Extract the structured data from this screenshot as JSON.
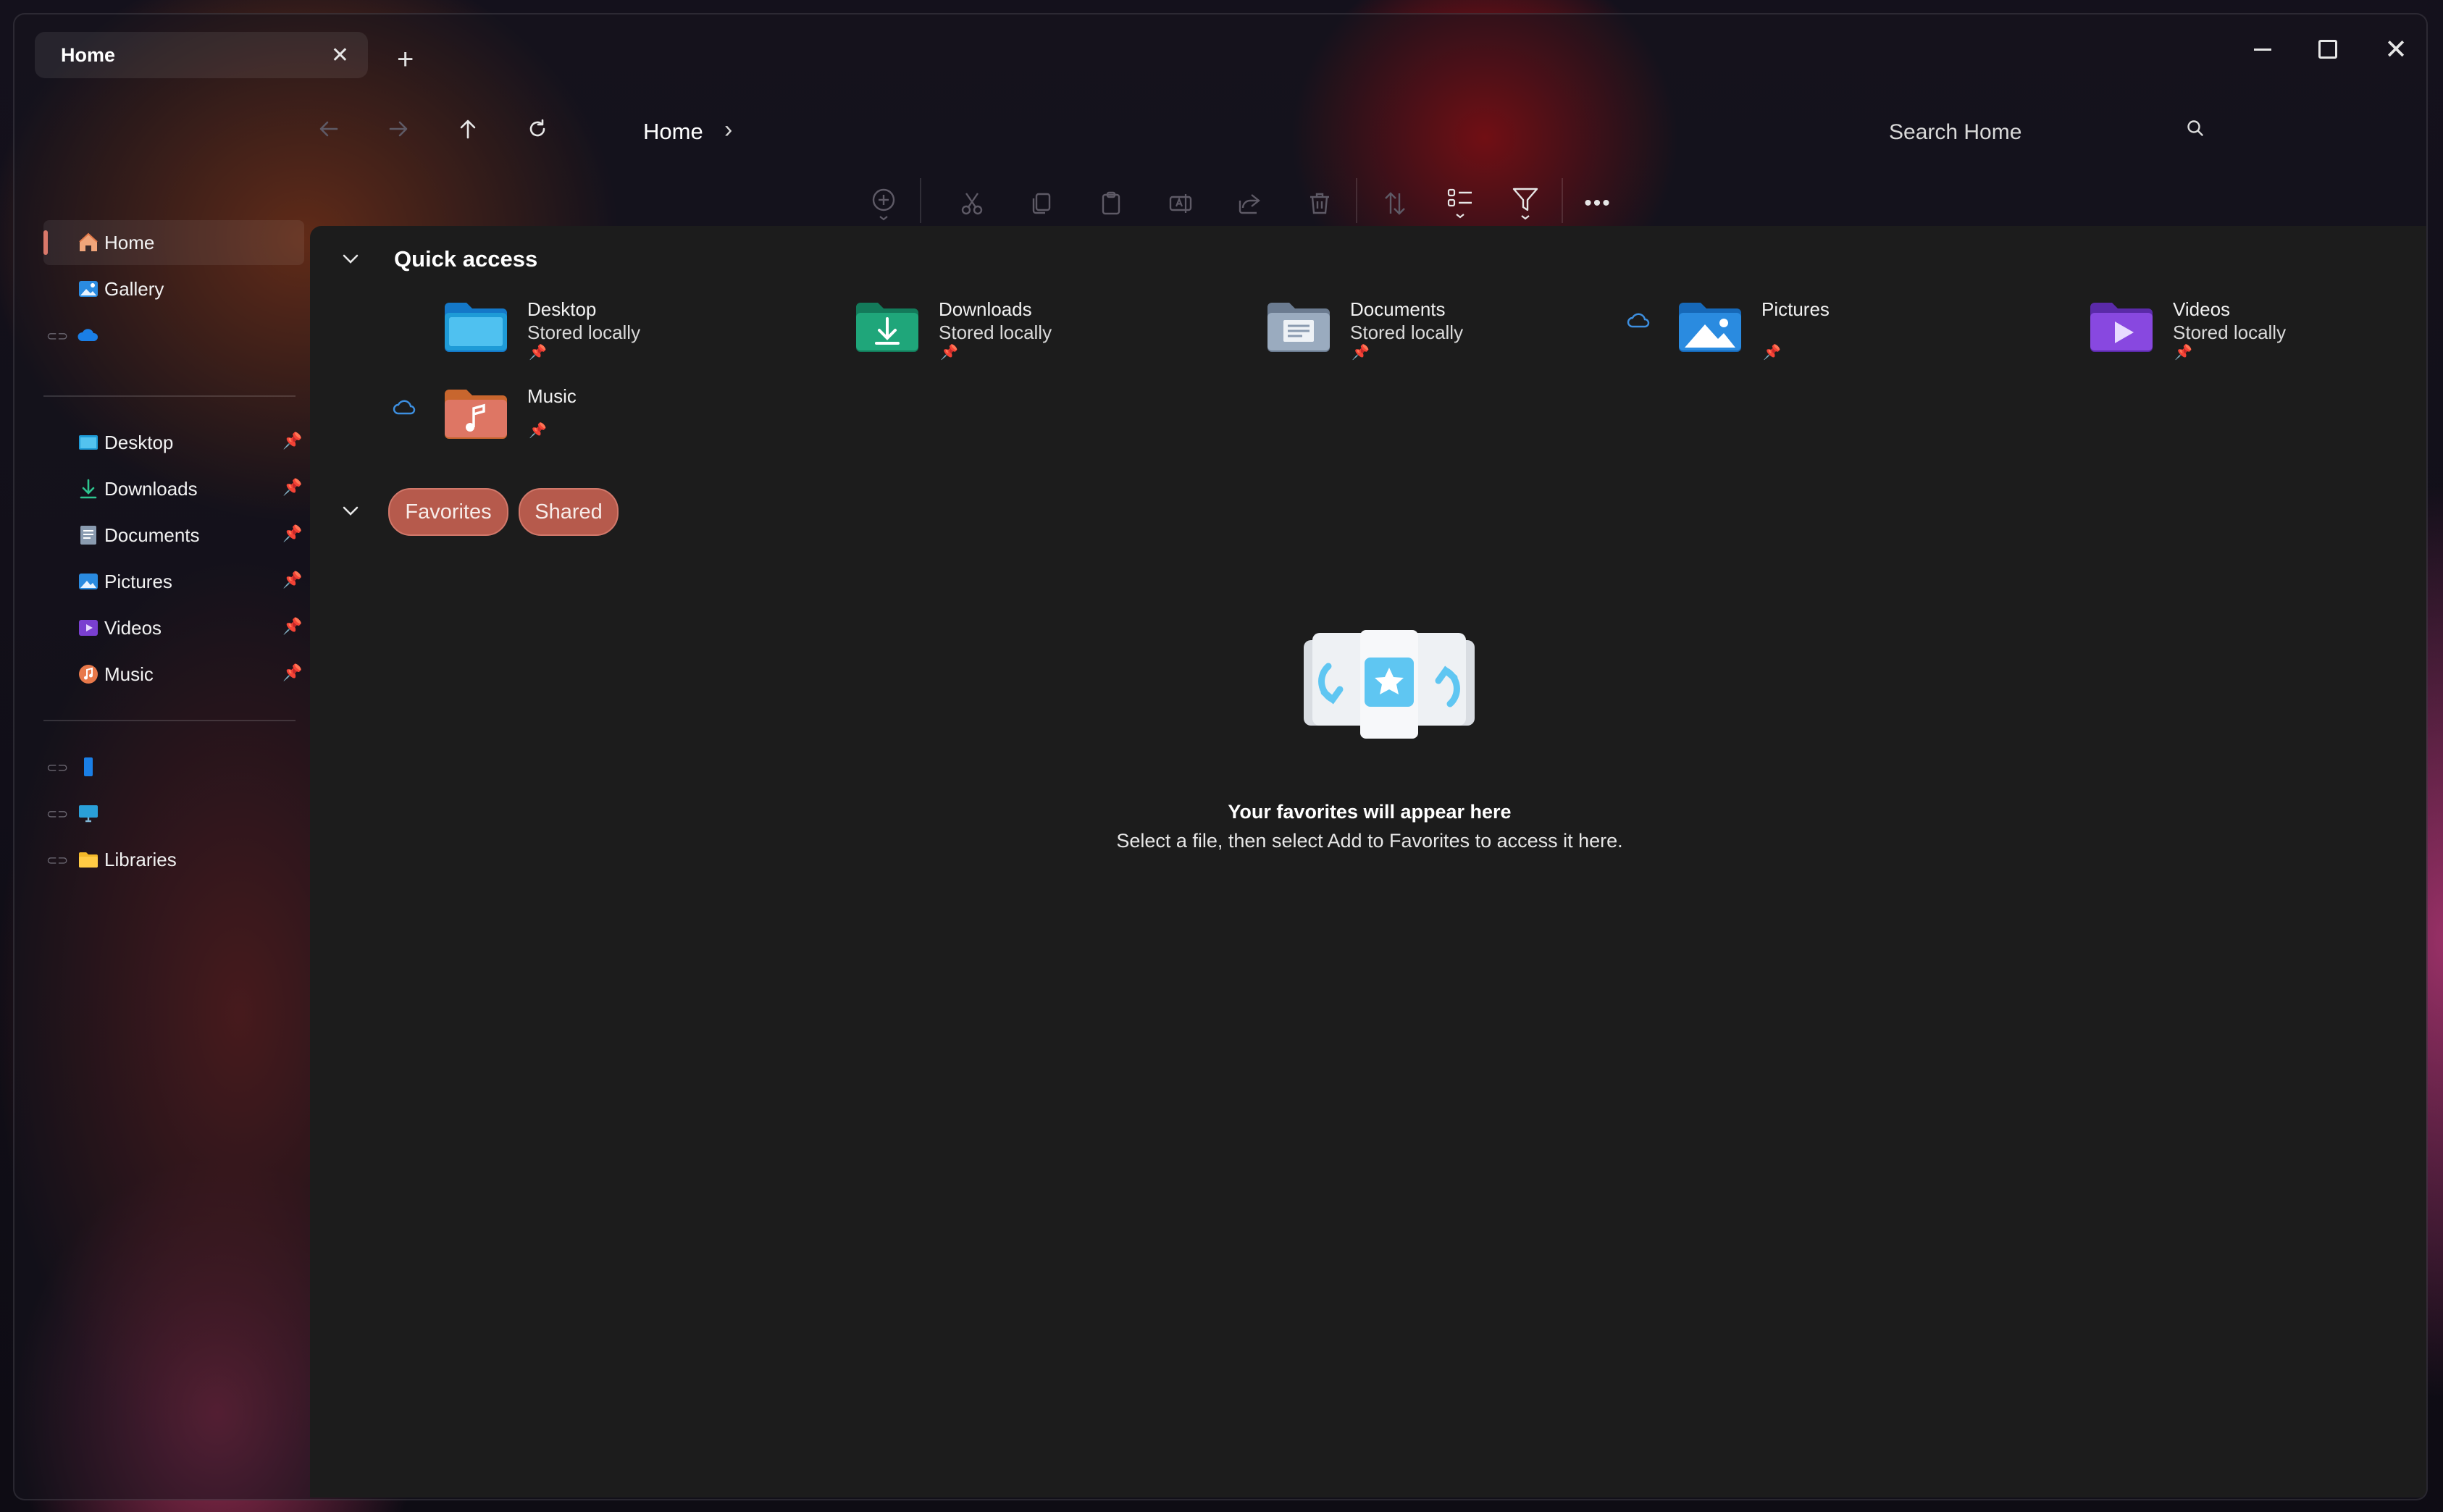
{
  "window": {
    "tab": {
      "title": "Home",
      "close_glyph": "✕"
    },
    "new_tab_glyph": "+",
    "controls": {
      "close_glyph": "✕"
    }
  },
  "nav": {
    "back_icon": "arrow-left-icon",
    "forward_icon": "arrow-right-icon",
    "up_icon": "arrow-up-icon",
    "refresh_icon": "refresh-icon",
    "breadcrumb": [
      "Home"
    ],
    "breadcrumb_chevron": "›",
    "search_placeholder": "Search Home"
  },
  "toolbar": {
    "items": [
      "new-icon",
      "cut-icon",
      "copy-icon",
      "paste-icon",
      "rename-icon",
      "share-icon",
      "delete-icon",
      "sort-icon",
      "view-icon",
      "filter-icon",
      "more-icon"
    ],
    "more_glyph": "•••"
  },
  "sidebar": {
    "top": [
      {
        "label": "Home",
        "icon": "home-icon",
        "selected": true
      },
      {
        "label": "Gallery",
        "icon": "gallery-icon"
      },
      {
        "label": "",
        "icon": "onedrive-icon"
      }
    ],
    "pinned": [
      {
        "label": "Desktop",
        "icon": "desktop-folder-icon"
      },
      {
        "label": "Downloads",
        "icon": "downloads-icon"
      },
      {
        "label": "Documents",
        "icon": "documents-icon"
      },
      {
        "label": "Pictures",
        "icon": "pictures-icon"
      },
      {
        "label": "Videos",
        "icon": "videos-icon"
      },
      {
        "label": "Music",
        "icon": "music-icon"
      }
    ],
    "pin_glyph": "📌",
    "bottom": [
      {
        "label": "",
        "icon": "phone-icon"
      },
      {
        "label": "",
        "icon": "this-pc-icon"
      },
      {
        "label": "Libraries",
        "icon": "libraries-folder-icon"
      }
    ]
  },
  "quick_access": {
    "title": "Quick access",
    "pin_glyph": "📌",
    "items": [
      {
        "name": "Desktop",
        "status": "Stored locally",
        "icon": "desktop-folder-icon",
        "color": "#1e9bd7"
      },
      {
        "name": "Downloads",
        "status": "Stored locally",
        "icon": "downloads-folder-icon",
        "color": "#1fa67a"
      },
      {
        "name": "Documents",
        "status": "Stored locally",
        "icon": "documents-folder-icon",
        "color": "#8a9bb0"
      },
      {
        "name": "Pictures",
        "status": "",
        "icon": "pictures-folder-icon",
        "color": "#2a8be0"
      },
      {
        "name": "Videos",
        "status": "Stored locally",
        "icon": "videos-folder-icon",
        "color": "#7a3fd0"
      },
      {
        "name": "Music",
        "status": "",
        "icon": "music-folder-icon",
        "color": "#e8894a"
      }
    ]
  },
  "favorites": {
    "tabs": [
      "Favorites",
      "Shared"
    ],
    "empty_title": "Your favorites will appear here",
    "empty_desc": "Select a file, then select Add to Favorites to access it here."
  },
  "colors": {
    "accent": "#d9786a",
    "pill": "#b65a4c",
    "content_bg": "#1c1c1c"
  }
}
